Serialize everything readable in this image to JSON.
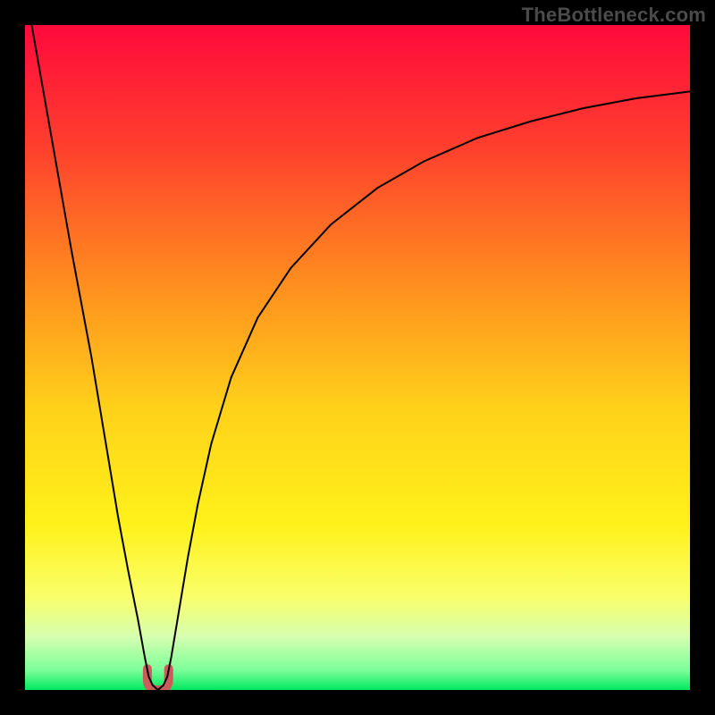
{
  "watermark": "TheBottleneck.com",
  "chart_data": {
    "type": "line",
    "title": "",
    "xlabel": "",
    "ylabel": "",
    "xlim": [
      0,
      100
    ],
    "ylim": [
      0,
      100
    ],
    "gradient_stops": [
      {
        "offset": 0,
        "color": "#ff0a3c"
      },
      {
        "offset": 0.18,
        "color": "#ff3e2e"
      },
      {
        "offset": 0.38,
        "color": "#ff8a1f"
      },
      {
        "offset": 0.58,
        "color": "#ffd21a"
      },
      {
        "offset": 0.75,
        "color": "#fff11a"
      },
      {
        "offset": 0.86,
        "color": "#f9ff6a"
      },
      {
        "offset": 0.92,
        "color": "#d6ffb0"
      },
      {
        "offset": 0.97,
        "color": "#7dff9a"
      },
      {
        "offset": 1.0,
        "color": "#00e85e"
      }
    ],
    "series": [
      {
        "name": "curve",
        "x": [
          1.0,
          4.0,
          7.0,
          10.0,
          12.0,
          14.0,
          15.5,
          17.0,
          18.0,
          18.6,
          19.2,
          20.0,
          20.8,
          21.4,
          22.0,
          23.0,
          24.5,
          26.0,
          28.0,
          31.0,
          35.0,
          40.0,
          46.0,
          53.0,
          60.0,
          68.0,
          76.0,
          84.0,
          92.0,
          100.0
        ],
        "y": [
          100.0,
          83.0,
          66.0,
          50.0,
          38.0,
          26.0,
          18.0,
          10.5,
          5.0,
          2.0,
          0.7,
          0.0,
          0.7,
          2.0,
          5.0,
          11.0,
          20.0,
          28.0,
          37.0,
          47.0,
          56.0,
          63.5,
          70.0,
          75.5,
          79.5,
          83.0,
          85.5,
          87.5,
          89.0,
          90.0
        ]
      }
    ],
    "minimum_marker": {
      "x_range": [
        18.4,
        21.6
      ],
      "y_range": [
        0,
        3.2
      ],
      "color": "#cc5b5b"
    }
  }
}
